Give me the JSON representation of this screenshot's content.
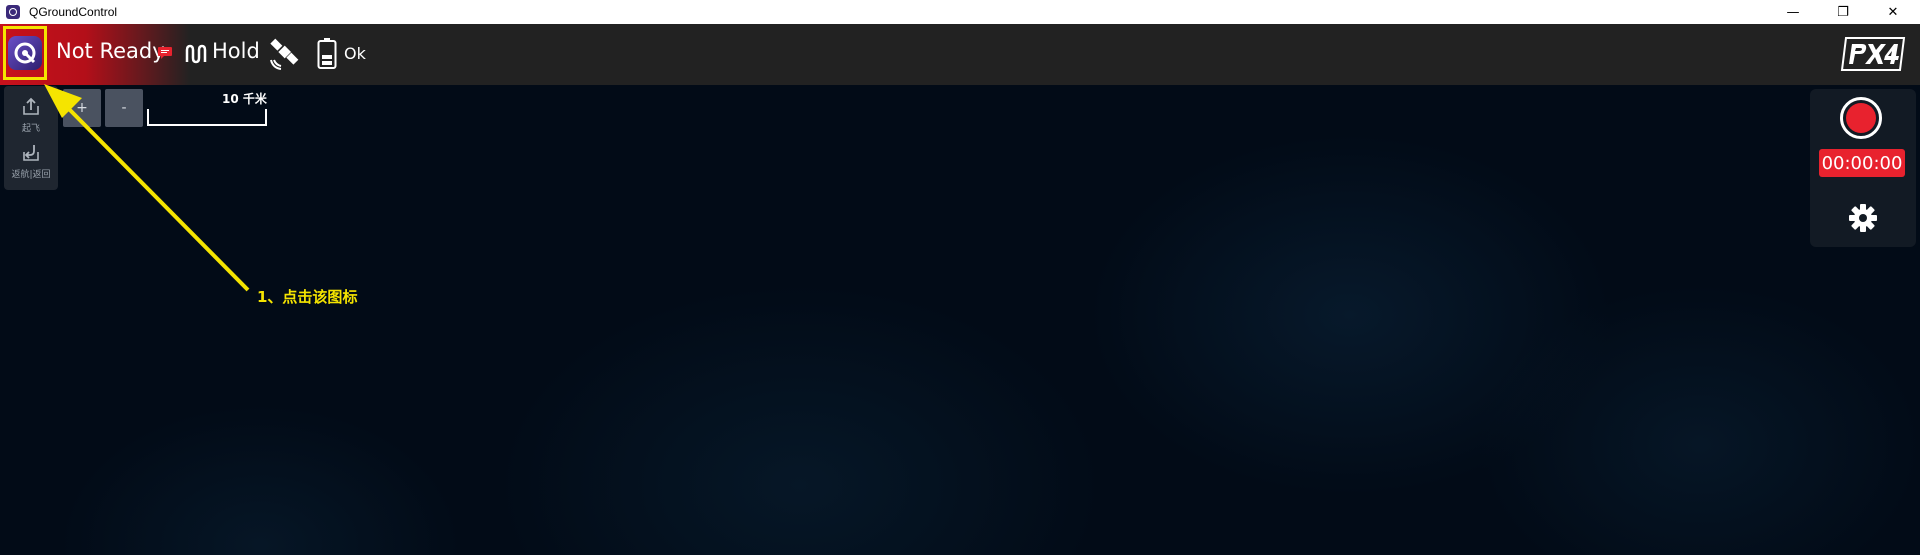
{
  "window": {
    "title": "QGroundControl",
    "minimize_glyph": "—",
    "restore_glyph": "❐",
    "close_glyph": "✕"
  },
  "toolbar": {
    "vehicle_status": "Not Ready",
    "flight_mode": "Hold",
    "battery_status": "Ok",
    "icons": [
      "qgc-logo-icon",
      "message-icon",
      "flight-mode-icon",
      "gps-icon",
      "battery-icon",
      "px4-logo"
    ]
  },
  "toolstrip": {
    "takeoff_label": "起飞",
    "return_label": "返航|返回"
  },
  "map": {
    "zoom_in_label": "+",
    "zoom_out_label": "-",
    "scale_label": "10 千米"
  },
  "camera_panel": {
    "timer": "00:00:00",
    "icons": [
      "record-icon",
      "gear-icon"
    ]
  },
  "annotation": {
    "text": "1、点击该图标",
    "color": "#f5e400"
  },
  "colors": {
    "accent_red": "#e8222e",
    "status_red": "#c8111c",
    "highlight_yellow": "#f5e400",
    "map_background": "#020b17",
    "toolbar_background": "#222222"
  }
}
